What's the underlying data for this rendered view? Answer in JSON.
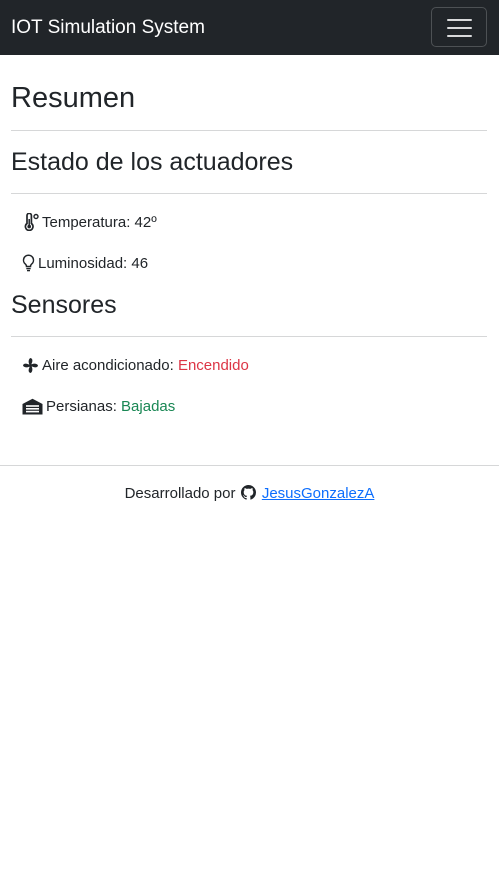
{
  "navbar": {
    "brand": "IOT Simulation System",
    "toggle_icon": "hamburger-menu-icon",
    "background": "#212529"
  },
  "resumen": {
    "title": "Resumen"
  },
  "actuadores": {
    "title": "Estado de los actuadores",
    "items": [
      {
        "icon": "thermometer-icon",
        "label": "Temperatura:",
        "value": "42º"
      },
      {
        "icon": "lightbulb-icon",
        "label": "Luminosidad:",
        "value": "46"
      }
    ]
  },
  "sensores": {
    "title": "Sensores",
    "items": [
      {
        "icon": "fan-icon",
        "label": "Aire acondicionado:",
        "value": "Encendido",
        "value_color": "#dc3545"
      },
      {
        "icon": "garage-icon",
        "label": "Persianas:",
        "value": "Bajadas",
        "value_color": "#198754"
      }
    ]
  },
  "footer": {
    "prefix": "Desarrollado por",
    "icon": "github-icon",
    "link_text": "JesusGonzalezA"
  }
}
